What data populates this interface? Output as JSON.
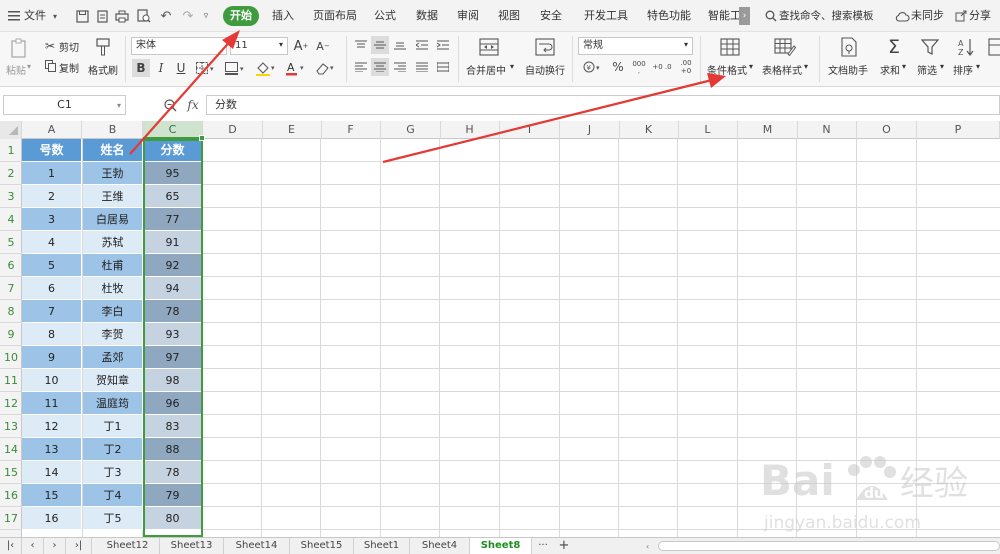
{
  "menubar": {
    "file_label": "文件",
    "tabs": [
      "开始",
      "插入",
      "页面布局",
      "公式",
      "数据",
      "审阅",
      "视图",
      "安全",
      "开发工具",
      "特色功能",
      "智能工"
    ],
    "active_tab": "开始",
    "search_label": "查找命令、搜索模板",
    "sync_label": "未同步",
    "share_label": "分享"
  },
  "ribbon": {
    "paste_label": "粘贴",
    "cut_label": "剪切",
    "copy_label": "复制",
    "format_painter_label": "格式刷",
    "font_name": "宋体",
    "font_size": "11",
    "bold": "B",
    "italic": "I",
    "underline": "U",
    "merge_label": "合并居中",
    "wrap_label": "自动换行",
    "number_format": "常规",
    "percent": "%",
    "thousands": "000",
    "inc_dec": "+0 .0",
    "dec_dec": ".00 +0",
    "cond_format_label": "条件格式",
    "table_style_label": "表格样式",
    "doc_helper_label": "文档助手",
    "sum_label": "求和",
    "filter_label": "筛选",
    "sort_label": "排序",
    "grow_font": "A",
    "shrink_font": "A"
  },
  "formula_bar": {
    "name_box": "C1",
    "fx_label": "fx",
    "value": "分数"
  },
  "columns": [
    "A",
    "B",
    "C",
    "D",
    "E",
    "F",
    "G",
    "H",
    "I",
    "J",
    "K",
    "L",
    "M",
    "N",
    "O",
    "P"
  ],
  "rows": [
    "1",
    "2",
    "3",
    "4",
    "5",
    "6",
    "7",
    "8",
    "9",
    "10",
    "11",
    "12",
    "13",
    "14",
    "15",
    "16",
    "17"
  ],
  "table": {
    "headers": [
      "号数",
      "姓名",
      "分数"
    ],
    "data": [
      [
        "1",
        "王勃",
        "95"
      ],
      [
        "2",
        "王维",
        "65"
      ],
      [
        "3",
        "白居易",
        "77"
      ],
      [
        "4",
        "苏轼",
        "91"
      ],
      [
        "5",
        "杜甫",
        "92"
      ],
      [
        "6",
        "杜牧",
        "94"
      ],
      [
        "7",
        "李白",
        "78"
      ],
      [
        "8",
        "李贺",
        "93"
      ],
      [
        "9",
        "孟郊",
        "97"
      ],
      [
        "10",
        "贺知章",
        "98"
      ],
      [
        "11",
        "温庭筠",
        "96"
      ],
      [
        "12",
        "丁1",
        "83"
      ],
      [
        "13",
        "丁2",
        "88"
      ],
      [
        "14",
        "丁3",
        "78"
      ],
      [
        "15",
        "丁4",
        "79"
      ],
      [
        "16",
        "丁5",
        "80"
      ]
    ]
  },
  "sheets": [
    "Sheet12",
    "Sheet13",
    "Sheet14",
    "Sheet15",
    "Sheet1",
    "Sheet4",
    "Sheet8"
  ],
  "active_sheet": "Sheet8",
  "colors": {
    "accent_green": "#3e9b3e",
    "header_blue": "#5b9bd5",
    "row_dark": "#9dc3e6",
    "row_light": "#ddebf7",
    "col_c_dark": "#8fa8c0",
    "col_c_light": "#c5d3e0",
    "arrow_red": "#e53935"
  },
  "watermark": {
    "brand": "Bai",
    "brand2": "经验",
    "url": "jingyan.baidu.com"
  }
}
